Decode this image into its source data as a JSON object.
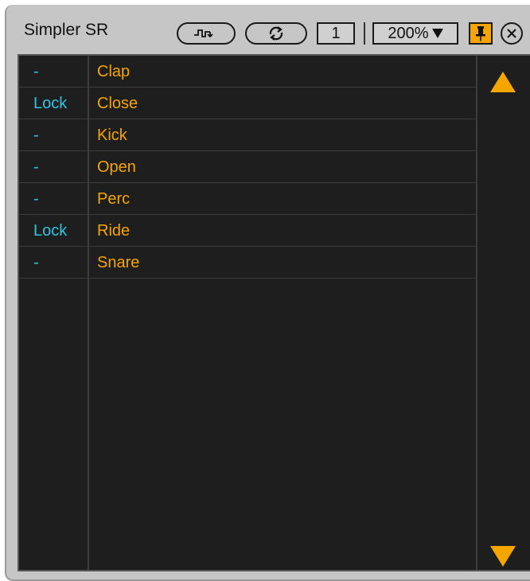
{
  "window": {
    "title": "Simpler SR"
  },
  "toolbar": {
    "zoom_value": "200%",
    "channel_number": "1"
  },
  "colors": {
    "accent": "#f5a500",
    "lock_text": "#2ec4e0",
    "panel_bg": "#1e1e1e",
    "window_bg": "#c6c6c6"
  },
  "icons": {
    "wave": "wave-arrow-icon",
    "loop": "loop-arrow-icon",
    "pin": "pin-icon",
    "close": "close-icon",
    "up": "scroll-up-arrow-icon",
    "down": "scroll-down-arrow-icon"
  },
  "list": {
    "rows": [
      {
        "status": "-",
        "name": "Clap"
      },
      {
        "status": "Lock",
        "name": "Close"
      },
      {
        "status": "-",
        "name": "Kick"
      },
      {
        "status": "-",
        "name": "Open"
      },
      {
        "status": "-",
        "name": "Perc"
      },
      {
        "status": "Lock",
        "name": "Ride"
      },
      {
        "status": "-",
        "name": "Snare"
      }
    ]
  }
}
